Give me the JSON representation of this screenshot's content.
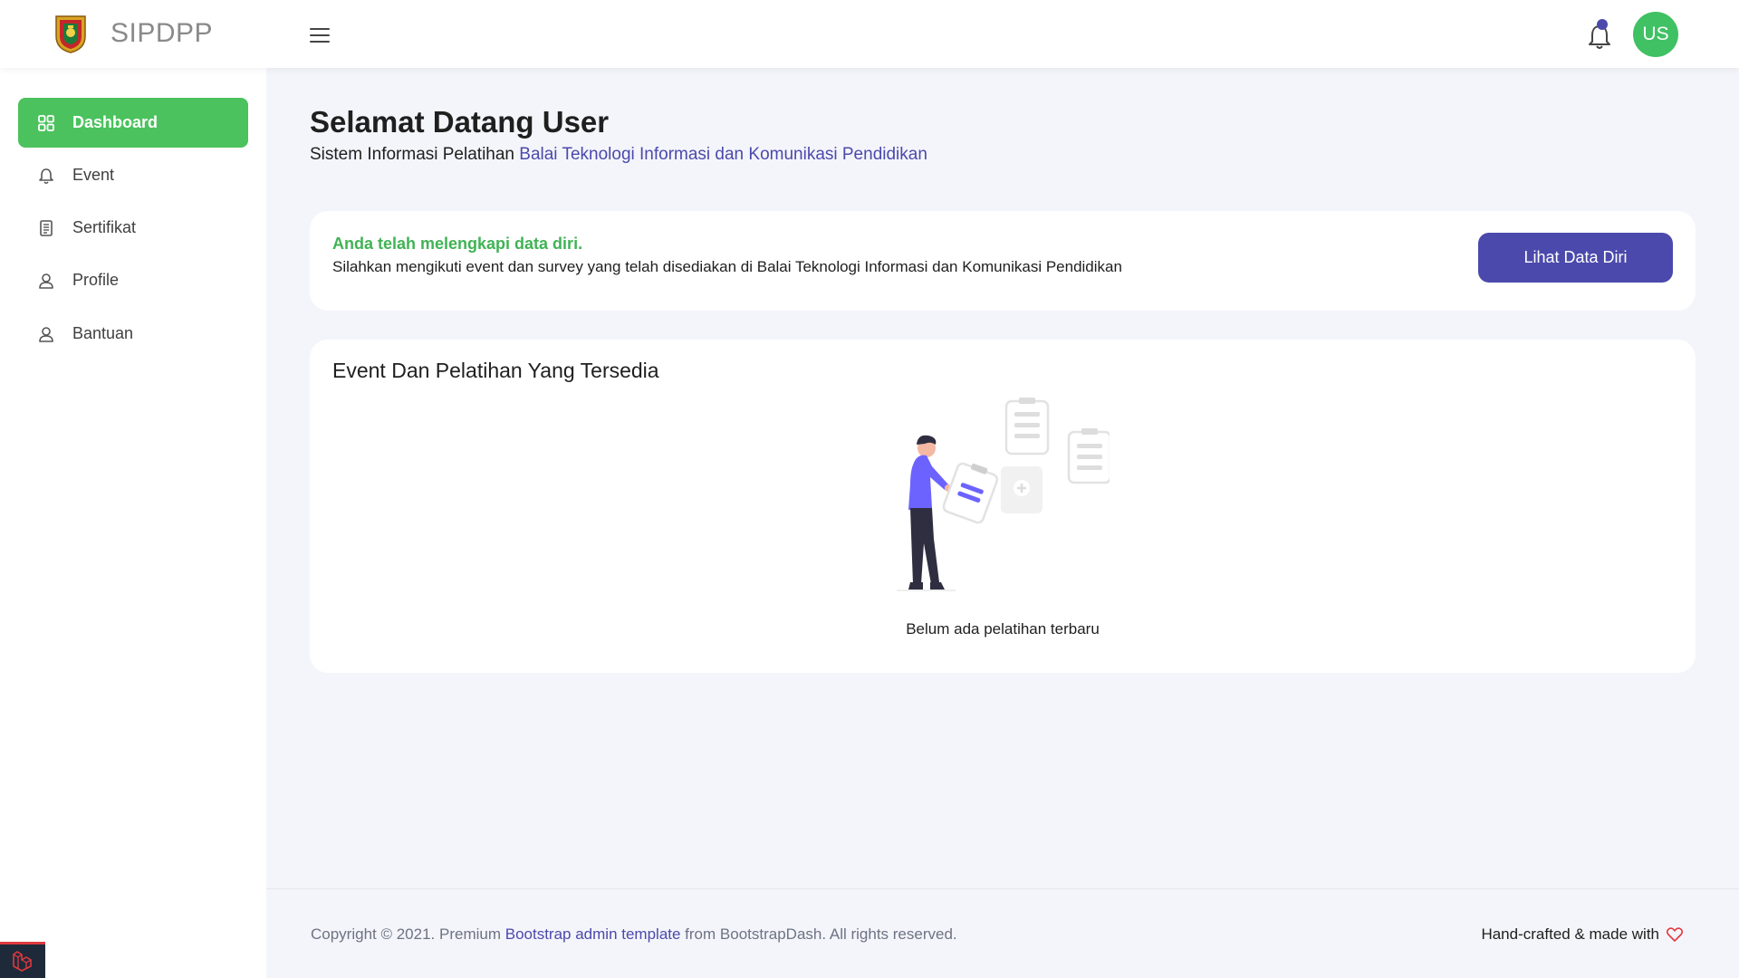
{
  "header": {
    "brand": "SIPDPP",
    "avatar_initials": "US",
    "colors": {
      "accent": "#4b49ac",
      "success": "#4bc25d"
    }
  },
  "sidebar": {
    "items": [
      {
        "label": "Dashboard",
        "icon": "grid-icon",
        "active": true
      },
      {
        "label": "Event",
        "icon": "bell-icon",
        "active": false
      },
      {
        "label": "Sertifikat",
        "icon": "document-icon",
        "active": false
      },
      {
        "label": "Profile",
        "icon": "user-icon",
        "active": false
      },
      {
        "label": "Bantuan",
        "icon": "user-icon",
        "active": false
      }
    ]
  },
  "main": {
    "title": "Selamat Datang User",
    "subtitle_prefix": "Sistem Informasi Pelatihan ",
    "subtitle_link": "Balai Teknologi Informasi dan Komunikasi Pendidikan",
    "info_card": {
      "title": "Anda telah melengkapi data diri.",
      "text": "Silahkan mengikuti event dan survey yang telah disediakan di Balai Teknologi Informasi dan Komunikasi Pendidikan",
      "button_label": "Lihat Data Diri"
    },
    "event_card": {
      "title": "Event Dan Pelatihan Yang Tersedia",
      "empty_text": "Belum ada pelatihan terbaru"
    }
  },
  "footer": {
    "copyright_prefix": "Copyright © 2021. Premium ",
    "copyright_link": "Bootstrap admin template",
    "copyright_suffix": " from BootstrapDash. All rights reserved.",
    "right_text": "Hand-crafted & made with"
  }
}
